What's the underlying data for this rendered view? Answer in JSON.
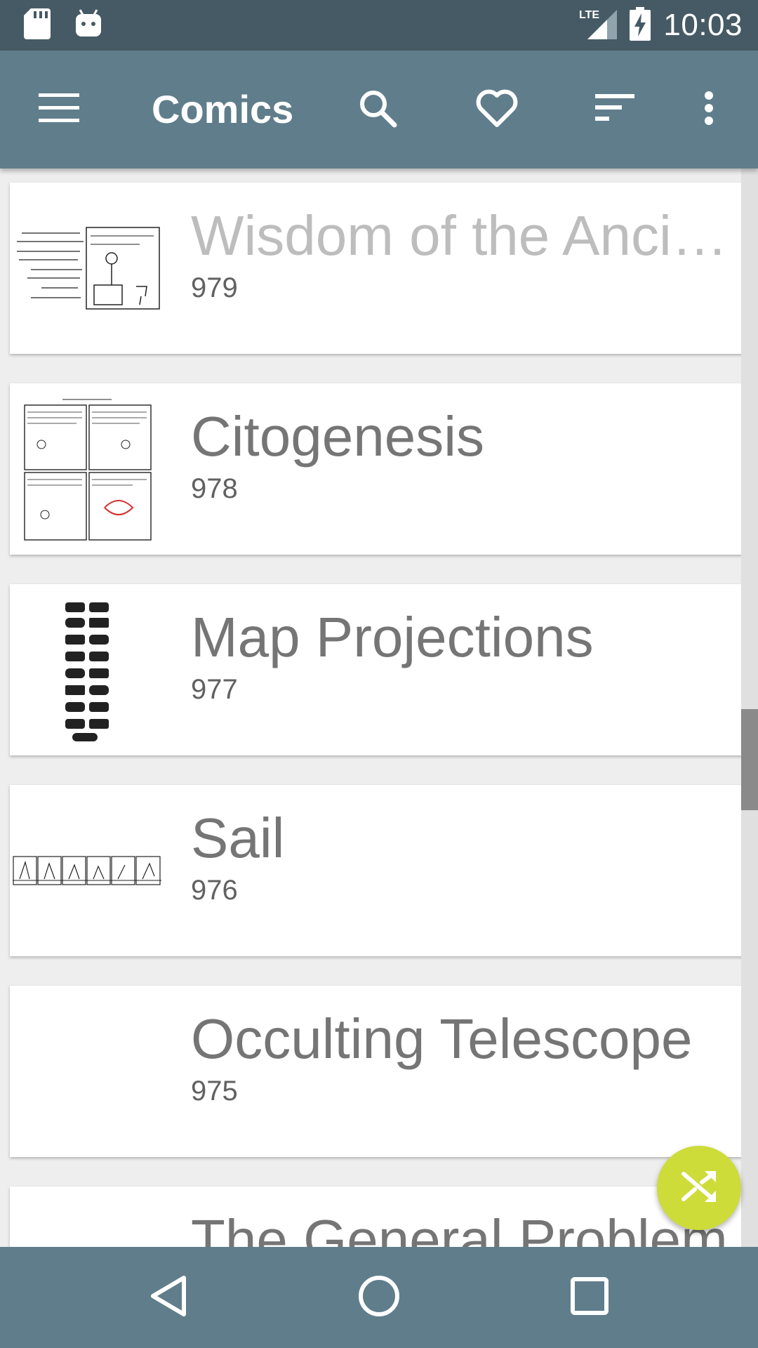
{
  "status_bar": {
    "network": "LTE",
    "time": "10:03",
    "icons": [
      "sd-card-icon",
      "android-icon",
      "lte-signal-icon",
      "battery-charging-icon"
    ]
  },
  "app_bar": {
    "title": "Comics",
    "icons": [
      "menu-icon",
      "search-icon",
      "heart-icon",
      "sort-icon",
      "more-vert-icon"
    ]
  },
  "comics": [
    {
      "title": "Wisdom of the Ancients",
      "number": "979"
    },
    {
      "title": "Citogenesis",
      "number": "978"
    },
    {
      "title": "Map Projections",
      "number": "977"
    },
    {
      "title": "Sail",
      "number": "976"
    },
    {
      "title": "Occulting Telescope",
      "number": "975"
    },
    {
      "title": "The General Problem",
      "number": ""
    }
  ],
  "fab": {
    "icon": "shuffle-icon"
  },
  "nav_bar": {
    "icons": [
      "back-icon",
      "home-icon",
      "recents-icon"
    ]
  },
  "colors": {
    "status_bar": "#455a64",
    "app_bar": "#607d8b",
    "fab": "#cddc39",
    "background": "#eeeeee"
  }
}
